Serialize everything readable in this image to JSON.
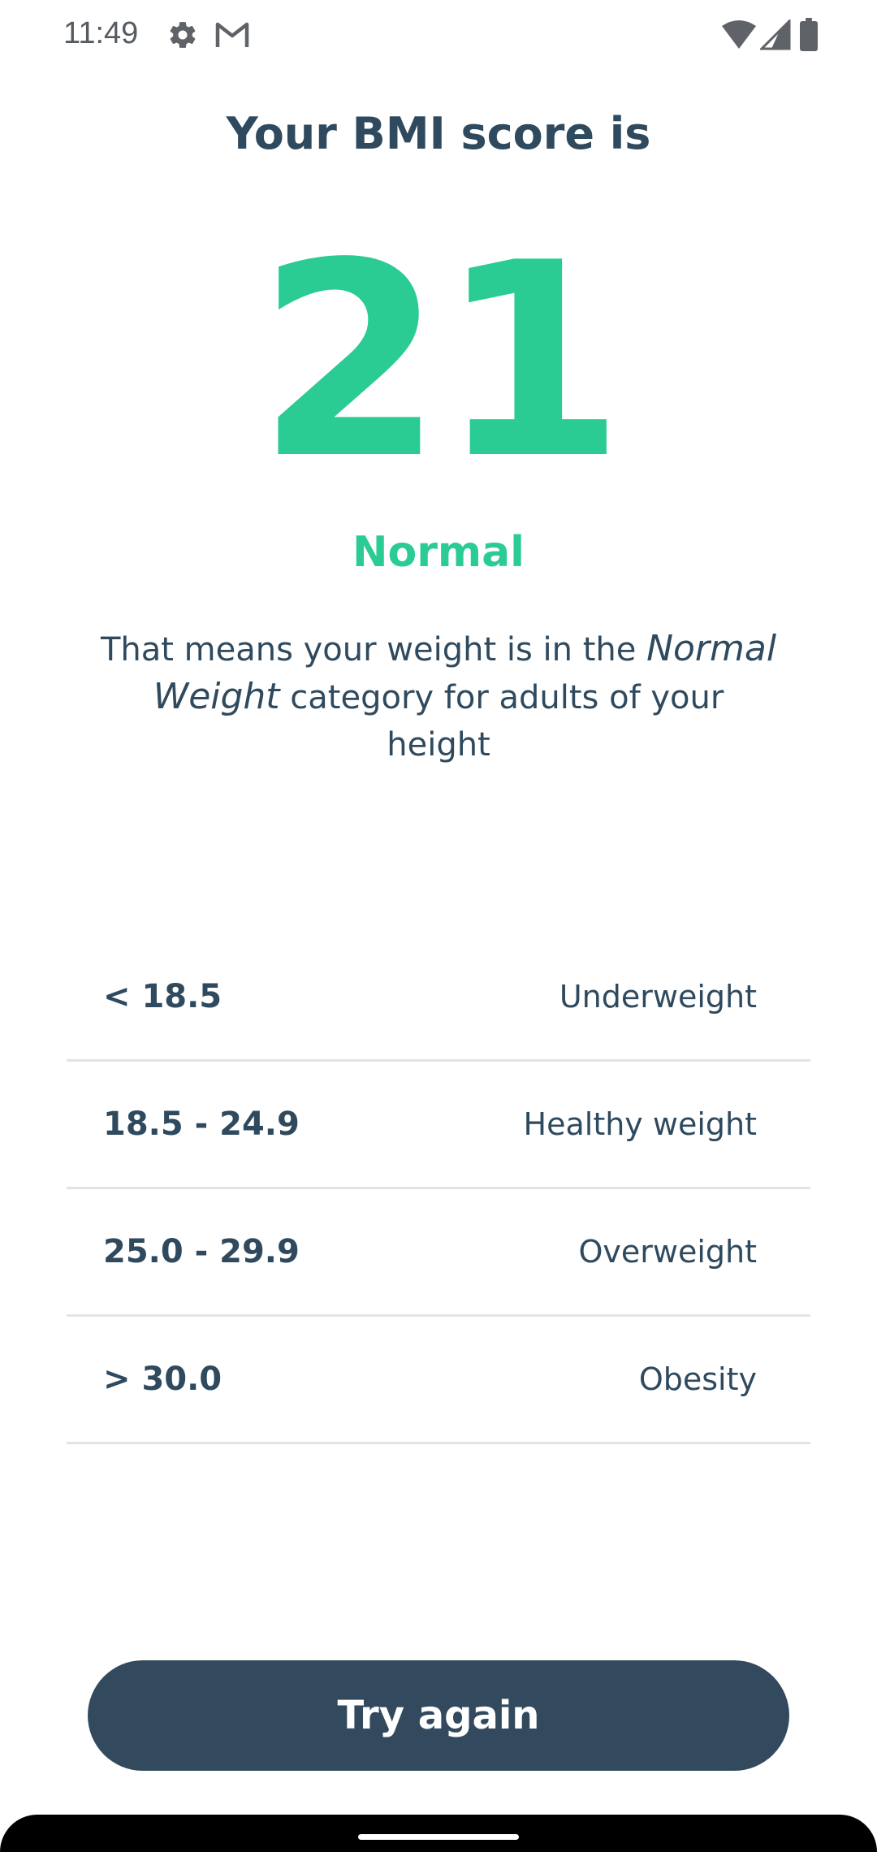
{
  "status_bar": {
    "time": "11:49",
    "icons": [
      "gear-icon",
      "gmail-icon",
      "wifi-icon",
      "cell-signal-icon",
      "battery-icon"
    ]
  },
  "header": {
    "title": "Your BMI score is"
  },
  "result": {
    "score": "21",
    "category": "Normal",
    "description_prefix": "That means your weight is in the ",
    "description_emphasis": "Normal Weight",
    "description_suffix": " category for adults of your height"
  },
  "bmi_table": {
    "rows": [
      {
        "range": "< 18.5",
        "label": "Underweight"
      },
      {
        "range": "18.5 - 24.9",
        "label": "Healthy weight"
      },
      {
        "range": "25.0 - 29.9",
        "label": "Overweight"
      },
      {
        "range": "> 30.0",
        "label": "Obesity"
      }
    ]
  },
  "actions": {
    "try_again_label": "Try again"
  },
  "colors": {
    "accent": "#2bcb94",
    "text": "#2f4a5e",
    "button": "#334a5e"
  }
}
